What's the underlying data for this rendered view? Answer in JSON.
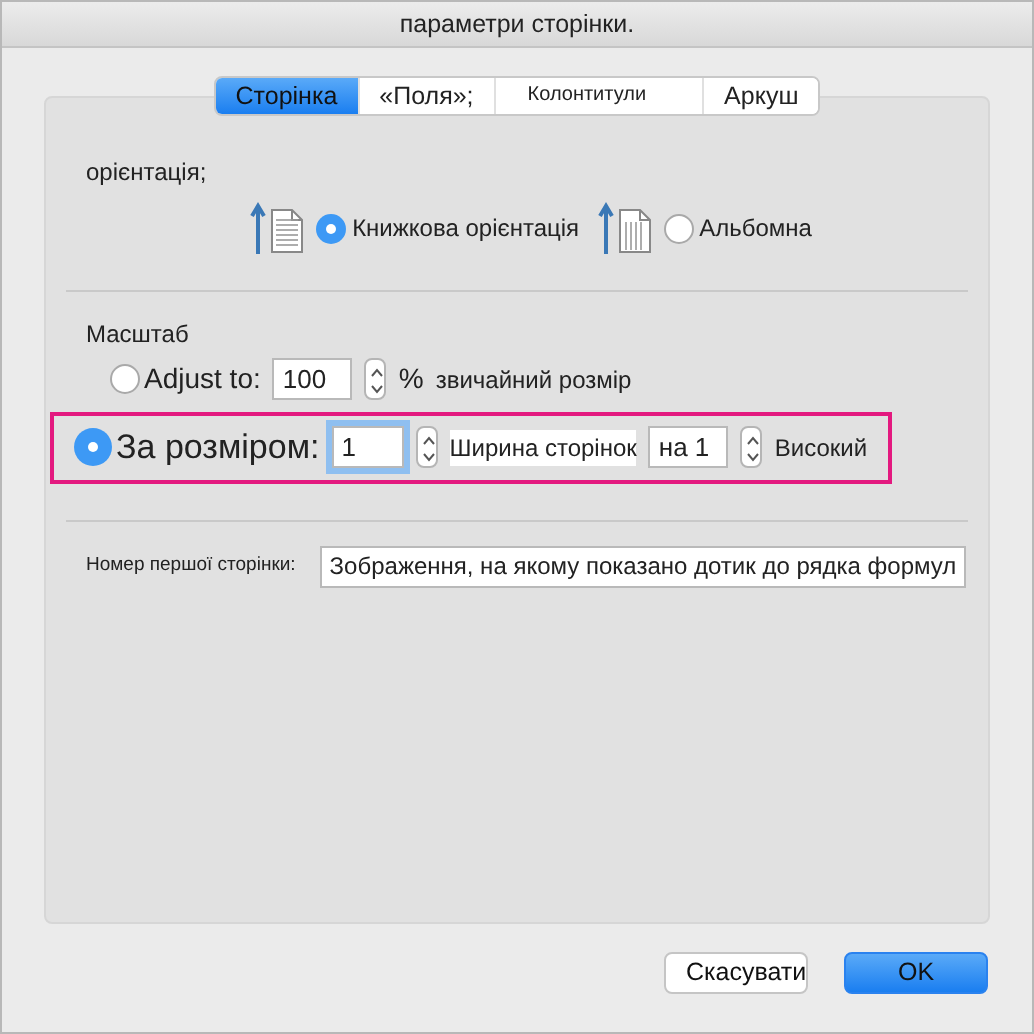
{
  "window": {
    "title": "параметри сторінки."
  },
  "tabs": [
    {
      "label": "Сторінка",
      "selected": true
    },
    {
      "label": "«Поля»;",
      "selected": false
    },
    {
      "label": "Колонтитули",
      "selected": false
    },
    {
      "label": "Аркуш",
      "selected": false
    }
  ],
  "orientation": {
    "label": "орієнтація;",
    "options": [
      {
        "label": "Книжкова орієнтація",
        "kind": "portrait",
        "selected": true
      },
      {
        "label": "Альбомна",
        "kind": "landscape",
        "selected": false
      }
    ]
  },
  "scaling": {
    "label": "Масштаб",
    "adjust": {
      "label": "Adjust to:",
      "selected": false,
      "value": "100",
      "unit": "%",
      "note": "звичайний розмір"
    },
    "fit": {
      "label": "За розміром:",
      "selected": true,
      "wide_value": "1",
      "wide_label": "Ширина сторінок",
      "tall_value": "на 1",
      "tall_label": "Високий",
      "highlighted": true
    }
  },
  "first_page": {
    "label": "Номер першої сторінки:",
    "value": "Зображення, на якому показано дотик до рядка формул"
  },
  "buttons": [
    {
      "label": "Скасувати",
      "kind": "cancel"
    },
    {
      "label": "OK",
      "kind": "default"
    }
  ]
}
